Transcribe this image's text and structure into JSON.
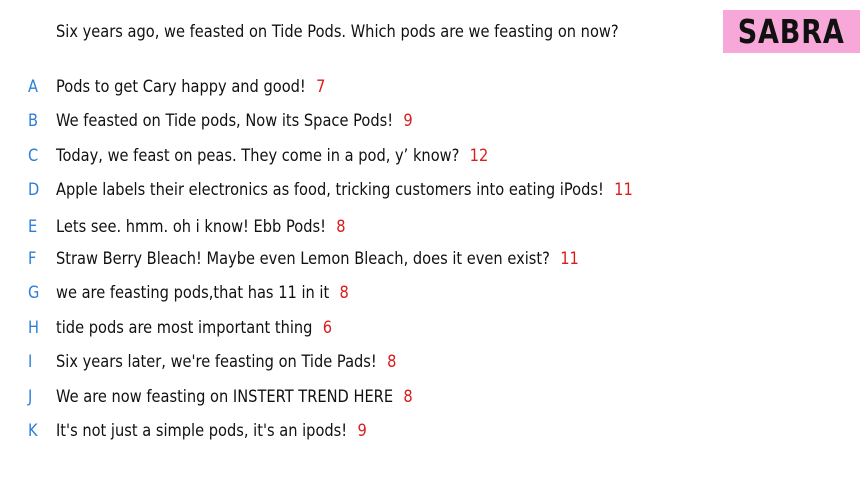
{
  "prompt": "Six years ago, we feasted on Tide Pods. Which pods are we feasting on now?",
  "badge": {
    "label": "SABRA",
    "color": "#f7a8d8"
  },
  "colors": {
    "letter": "#2b7fd8",
    "score": "#d91c1c",
    "text": "#111111"
  },
  "answers": [
    {
      "letter": "A",
      "text": "Pods to get Cary happy and good!",
      "score": "7"
    },
    {
      "letter": "B",
      "text": "We feasted on Tide pods, Now its Space Pods!",
      "score": "9"
    },
    {
      "letter": "C",
      "text": "Today, we feast on peas. They come in a pod, y’ know?",
      "score": "12"
    },
    {
      "letter": "D",
      "text": "Apple labels their electronics as food, tricking customers into eating iPods!",
      "score": "11"
    },
    {
      "letter": "E",
      "text": "Lets see. hmm. oh i know! Ebb Pods!",
      "score": "8"
    },
    {
      "letter": "F",
      "text": "Straw Berry Bleach! Maybe even Lemon Bleach, does it even exist?",
      "score": "11"
    },
    {
      "letter": "G",
      "text": "we are feasting pods,that has 11 in it",
      "score": "8"
    },
    {
      "letter": "H",
      "text": "tide pods are most important thing",
      "score": "6"
    },
    {
      "letter": "I",
      "text": "Six years later, we're feasting on Tide Pads!",
      "score": "8"
    },
    {
      "letter": "J",
      "text": "We are now feasting on INSTERT TREND HERE",
      "score": "8"
    },
    {
      "letter": "K",
      "text": "It's not just a simple pods, it's an ipods!",
      "score": "9"
    }
  ]
}
